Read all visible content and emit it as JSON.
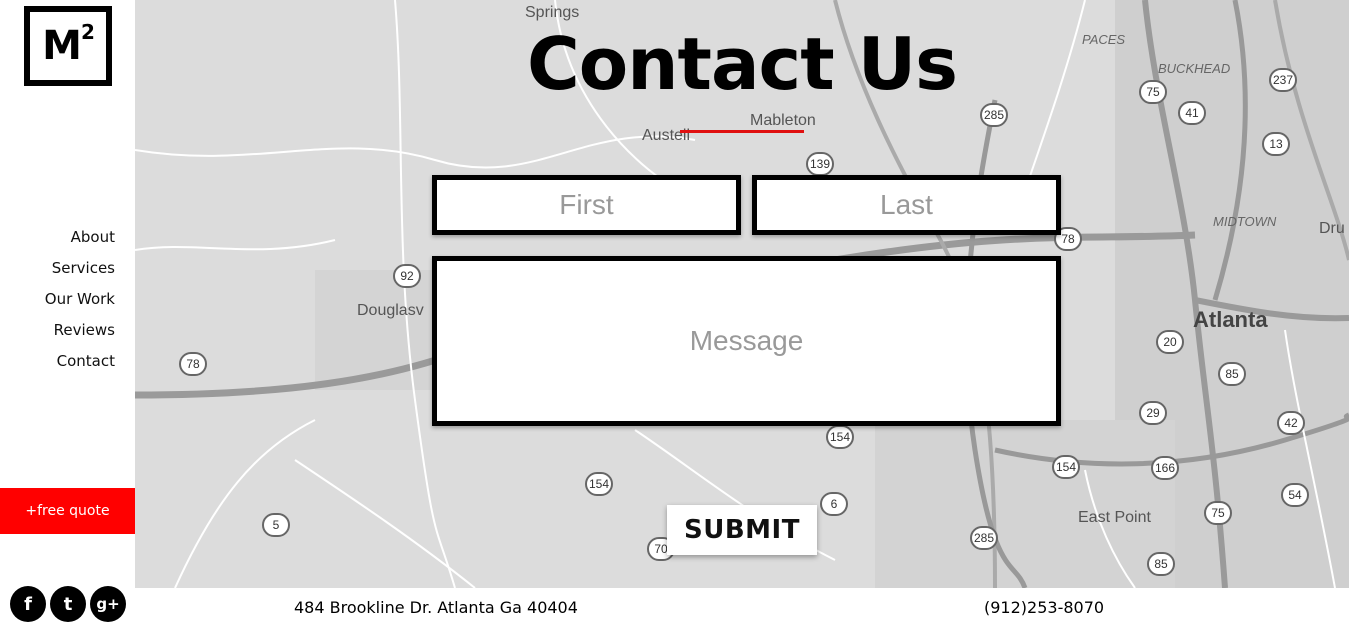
{
  "logo": {
    "text": "M",
    "sup": "2"
  },
  "nav": {
    "items": [
      {
        "label": "About"
      },
      {
        "label": "Services"
      },
      {
        "label": "Our Work"
      },
      {
        "label": "Reviews"
      },
      {
        "label": "Contact"
      }
    ]
  },
  "quote_button": "+free quote",
  "social": {
    "facebook": "f",
    "twitter": "t",
    "googleplus": "g+"
  },
  "heading": "Contact Us",
  "map": {
    "labels": {
      "springs": "Springs",
      "mableton": "Mableton",
      "austell": "Austell",
      "douglasville": "Douglasv",
      "atlanta": "Atlanta",
      "east_point": "East Point",
      "paces": "PACES",
      "buckhead": "BUCKHEAD",
      "midtown": "MIDTOWN",
      "dru": "Dru"
    },
    "shields": {
      "s139": "139",
      "s92": "92",
      "s78a": "78",
      "s285a": "285",
      "s75a": "75",
      "s41": "41",
      "s237": "237",
      "s13": "13",
      "s78b": "78",
      "s20": "20",
      "s85a": "85",
      "s29": "29",
      "s42": "42",
      "s154a": "154",
      "s154b": "154",
      "s166": "166",
      "s154c": "154",
      "s6": "6",
      "s5": "5",
      "s285b": "285",
      "s85b": "85",
      "s75b": "75",
      "s54": "54",
      "s70": "70"
    }
  },
  "form": {
    "first_placeholder": "First",
    "last_placeholder": "Last",
    "message_placeholder": "Message",
    "submit_label": "SUBMIT"
  },
  "footer": {
    "address": "484 Brookline Dr. Atlanta Ga 40404",
    "phone": "(912)253-8070"
  },
  "colors": {
    "accent": "#ff0000",
    "underline": "#e01010",
    "map_bg": "#dcdcdc"
  }
}
